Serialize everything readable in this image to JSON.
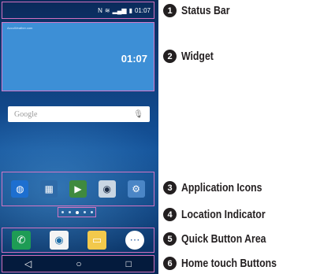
{
  "status_bar": {
    "time": "01:07",
    "icons": [
      "nfc-icon",
      "wifi-icon",
      "signal-icon",
      "battery-icon"
    ]
  },
  "widget": {
    "time": "01:07",
    "source": "AccuWeather.com"
  },
  "search": {
    "label": "Google",
    "mic_icon": "mic-icon"
  },
  "apps": [
    {
      "name": "browser-icon",
      "glyph": "◍",
      "color": "#1d6fd0"
    },
    {
      "name": "multimedia-folder-icon",
      "glyph": "▦",
      "color": "#2e6aa8"
    },
    {
      "name": "play-store-icon",
      "glyph": "▶",
      "color": "#3f8a3f"
    },
    {
      "name": "camera-icon",
      "glyph": "◉",
      "color": "#c9d6e3"
    },
    {
      "name": "settings-icon",
      "glyph": "⚙",
      "color": "#4b86c6"
    }
  ],
  "location": {
    "count": 5,
    "active": 2
  },
  "quick_buttons": [
    {
      "name": "phone-icon",
      "glyph": "✆",
      "color": "#1e9c55"
    },
    {
      "name": "contacts-icon",
      "glyph": "◉",
      "color": "#f4f4f4"
    },
    {
      "name": "messaging-icon",
      "glyph": "▭",
      "color": "#f2c94c"
    },
    {
      "name": "apps-icon",
      "glyph": "⋯",
      "color": "#ffffff"
    }
  ],
  "home_buttons": [
    "◁",
    "○",
    "□"
  ],
  "callouts": [
    {
      "number": "1",
      "label": "Status Bar"
    },
    {
      "number": "2",
      "label": "Widget"
    },
    {
      "number": "3",
      "label": "Application Icons"
    },
    {
      "number": "4",
      "label": "Location Indicator"
    },
    {
      "number": "5",
      "label": "Quick Button Area"
    },
    {
      "number": "6",
      "label": "Home touch Buttons"
    }
  ]
}
